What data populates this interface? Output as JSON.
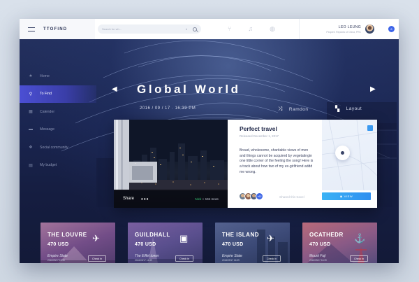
{
  "app": {
    "title": "TTOFIND"
  },
  "search": {
    "placeholder": "Search for wh...",
    "caret": "▾"
  },
  "top_icons": [
    "fork-knife-icon",
    "music-note-icon",
    "globe-icon"
  ],
  "user": {
    "name": "LEO LEUNG",
    "location": "People's Republic of China, PRC",
    "notifications": "8"
  },
  "sidebar": {
    "items": [
      {
        "label": "Home",
        "icon": "star-icon",
        "glyph": "★"
      },
      {
        "label": "To Find",
        "icon": "location-pin-icon",
        "glyph": "⚲",
        "active": true
      },
      {
        "label": "Calender",
        "icon": "calendar-icon",
        "glyph": "▦"
      },
      {
        "label": "Message",
        "icon": "message-icon",
        "glyph": "▬"
      },
      {
        "label": "Social community",
        "icon": "community-icon",
        "glyph": "❖"
      },
      {
        "label": "My budget",
        "icon": "budget-icon",
        "glyph": "▤"
      }
    ]
  },
  "hero": {
    "title": "Global World",
    "datetime": "2016 / 09 / 17 · 16:39 PM",
    "random_label": "Ramdon",
    "layout_label": "Layout",
    "prev_arrow": "◀",
    "next_arrow": "▶"
  },
  "feature": {
    "title": "Perfect travel",
    "released": "Released December 1, 2017",
    "description": "Broad, wholesome, sharitable views of men and things cannot be acquired by vegetatingin one little corner of the feeling the song! Here is a track about how two of my ex-girlfriend addd me wrong.",
    "share_label": "Share",
    "dots": "•••",
    "nick": "Nick",
    "more": "+ 194 more",
    "more_avatars": "+62",
    "shared_text": "Shared this travel",
    "view_label": "VIEW"
  },
  "tiles": [
    {
      "name": "THE LOUVRE",
      "price": "470 USD",
      "place": "Empire State",
      "date": "2016/09/17 16:39",
      "button": "Check in",
      "icon": "plane-icon",
      "glyph": "✈"
    },
    {
      "name": "GUILDHALL",
      "price": "470 USD",
      "place": "The Eiffel tower",
      "date": "2016/09/17 16:39",
      "button": "Check in",
      "icon": "bus-icon",
      "glyph": "▣"
    },
    {
      "name": "THE ISLAND",
      "price": "470 USD",
      "place": "Empire State",
      "date": "2016/09/17 16:39",
      "button": "Check in",
      "icon": "plane-icon",
      "glyph": "✈"
    },
    {
      "name": "OCATHEDR",
      "price": "470 USD",
      "place": "Mount Fuji",
      "date": "2016/09/17 16:39",
      "button": "Check in",
      "icon": "anchor-icon",
      "glyph": "⚓"
    }
  ]
}
